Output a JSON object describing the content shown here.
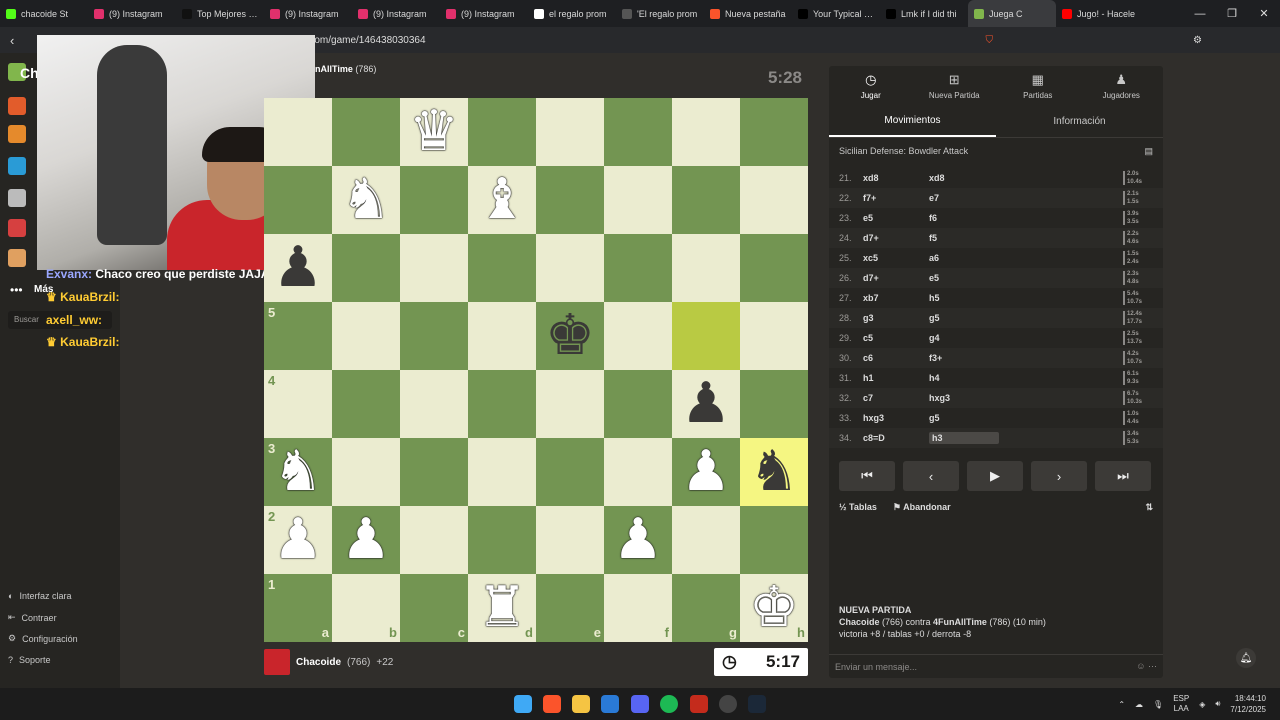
{
  "browser": {
    "tabs": [
      {
        "label": "chacoide St",
        "color": "#53fc18"
      },
      {
        "label": "(9) Instagram",
        "color": "#e1306c"
      },
      {
        "label": "Top Mejores Ch",
        "color": "#111111"
      },
      {
        "label": "(9) Instagram",
        "color": "#e1306c"
      },
      {
        "label": "(9) Instagram",
        "color": "#e1306c"
      },
      {
        "label": "(9) Instagram",
        "color": "#e1306c"
      },
      {
        "label": "el regalo prom",
        "color": "#ffffff"
      },
      {
        "label": "'El regalo prom",
        "color": "#555555"
      },
      {
        "label": "Nueva pestaña",
        "color": "#fb542b"
      },
      {
        "label": "Your Typical Lo",
        "color": "#000000"
      },
      {
        "label": "Lmk if I did thi",
        "color": "#000000"
      },
      {
        "label": "Juega C",
        "color": "#81b64c",
        "active": true
      },
      {
        "label": "Jugo! - Hacele",
        "color": "#ff0000"
      }
    ],
    "url": "om/game/146438030364"
  },
  "sidebar": {
    "logo_text": "Ch",
    "more_label": "Más",
    "search_label": "Buscar",
    "bottom": [
      "Interfaz clara",
      "Contraer",
      "Configuración",
      "Soporte"
    ]
  },
  "chat": [
    {
      "user": "Exvanx:",
      "text": "Chaco creo que perdiste JAJA",
      "color": "#9aa7ff"
    },
    {
      "user": "KauaBrzil:",
      "text": "",
      "color": "#ffcc33"
    },
    {
      "user": "axell_ww:",
      "text": "",
      "color": "#ffcc33"
    },
    {
      "user": "KauaBrzil:",
      "text": "",
      "color": "#ffcc33"
    }
  ],
  "game": {
    "opponent_name": "nAllTime",
    "opponent_rating": "(786)",
    "opponent_clock": "5:28",
    "player_name": "Chacoide",
    "player_rating": "(766)",
    "player_clock": "5:17",
    "player_material": "+22",
    "ranks": [
      "5",
      "4",
      "3",
      "2",
      "1"
    ],
    "files": [
      "a",
      "b",
      "c",
      "d",
      "e",
      "f",
      "g",
      "h"
    ],
    "board": [
      [
        "",
        "",
        "wQ",
        "",
        "",
        "",
        "",
        ""
      ],
      [
        "",
        "wN",
        "",
        "wB",
        "",
        "",
        "",
        ""
      ],
      [
        "bP",
        "",
        "",
        "",
        "",
        "",
        "",
        ""
      ],
      [
        "",
        "",
        "",
        "",
        "bK",
        "",
        "",
        ""
      ],
      [
        "",
        "",
        "",
        "",
        "",
        "",
        "bP",
        ""
      ],
      [
        "wN",
        "",
        "",
        "",
        "",
        "",
        "wP",
        "bN"
      ],
      [
        "wP",
        "wP",
        "",
        "",
        "",
        "wP",
        "",
        ""
      ],
      [
        "",
        "",
        "",
        "wR",
        "",
        "",
        "",
        "wK"
      ]
    ]
  },
  "panel": {
    "tabs": [
      "Jugar",
      "Nueva Partida",
      "Partidas",
      "Jugadores"
    ],
    "subtabs": [
      "Movimientos",
      "Información"
    ],
    "opening": "Sicilian Defense: Bowdler Attack",
    "moves": [
      {
        "n": "21.",
        "w": "xd8",
        "b": "xd8",
        "t": "2.0s 10.4s"
      },
      {
        "n": "22.",
        "w": "f7+",
        "b": "e7",
        "t": "2.1s 1.5s"
      },
      {
        "n": "23.",
        "w": "e5",
        "b": "f6",
        "t": "3.9s 3.5s"
      },
      {
        "n": "24.",
        "w": "d7+",
        "b": "f5",
        "t": "2.2s 4.6s"
      },
      {
        "n": "25.",
        "w": "xc5",
        "b": "a6",
        "t": "1.5s 2.4s"
      },
      {
        "n": "26.",
        "w": "d7+",
        "b": "e5",
        "t": "2.3s 4.8s"
      },
      {
        "n": "27.",
        "w": "xb7",
        "b": "h5",
        "t": "5.4s 10.7s"
      },
      {
        "n": "28.",
        "w": "g3",
        "b": "g5",
        "t": "12.4s 17.7s"
      },
      {
        "n": "29.",
        "w": "c5",
        "b": "g4",
        "t": "2.5s 13.7s"
      },
      {
        "n": "30.",
        "w": "c6",
        "b": "f3+",
        "t": "4.2s 10.7s"
      },
      {
        "n": "31.",
        "w": "h1",
        "b": "h4",
        "t": "6.1s 9.3s"
      },
      {
        "n": "32.",
        "w": "c7",
        "b": "hxg3",
        "t": "6.7s 10.3s"
      },
      {
        "n": "33.",
        "w": "hxg3",
        "b": "g5",
        "t": "1.0s 4.4s"
      },
      {
        "n": "34.",
        "w": "c8=D",
        "b": "h3",
        "t": "3.4s 5.3s"
      }
    ],
    "draw_label": "Tablas",
    "resign_label": "Abandonar",
    "new_game_title": "NUEVA PARTIDA",
    "new_game_line1_a": "Chacoide",
    "new_game_line1_b": " (766) contra ",
    "new_game_line1_c": "4FunAllTime",
    "new_game_line1_d": " (786) (10 min)",
    "new_game_line2": "victoria +8 / tablas +0 / derrota -8",
    "message_placeholder": "Enviar un mensaje..."
  },
  "taskbar": {
    "lang": "ESP",
    "lang2": "LAA",
    "time": "18:44:10",
    "date": "7/12/2025",
    "notif_count": "1"
  }
}
